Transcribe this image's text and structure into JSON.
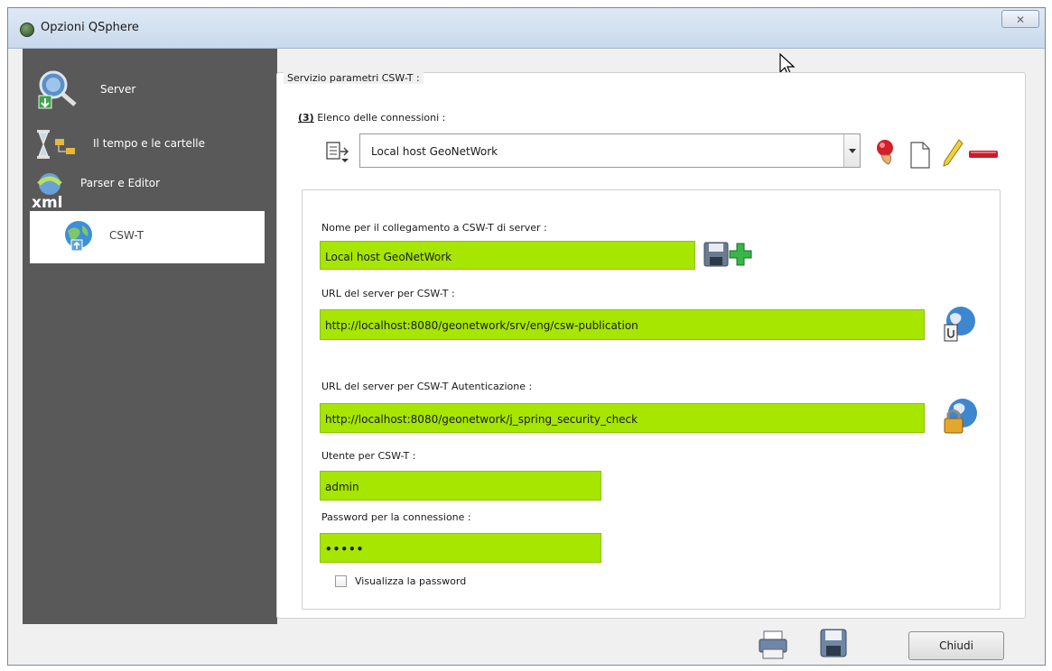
{
  "window": {
    "title": "Opzioni QSphere",
    "close_glyph": "✕"
  },
  "sidebar": {
    "items": [
      {
        "label": "Server",
        "icon": "search-server-icon"
      },
      {
        "label": "Il tempo e le cartelle",
        "icon": "hourglass-folder-icon"
      },
      {
        "label": "Parser e Editor",
        "icon": "xml-icon"
      },
      {
        "label": "CSW-T",
        "icon": "globe-icon",
        "selected": true
      }
    ]
  },
  "panel": {
    "legend": "Servizio parametri CSW-T :",
    "connections_number": "(3)",
    "connections_label": "Elenco delle connessioni :",
    "selected_connection": "Local host GeoNetWork",
    "name_label": "Nome per il collegamento a CSW-T di server :",
    "name_value": "Local host GeoNetWork",
    "url_label": "URL del server per CSW-T :",
    "url_value": "http://localhost:8080/geonetwork/srv/eng/csw-publication",
    "auth_url_label": "URL del server per CSW-T Autenticazione :",
    "auth_url_value": "http://localhost:8080/geonetwork/j_spring_security_check",
    "user_label": "Utente per CSW-T :",
    "user_value": "admin",
    "password_label": "Password per la connessione :",
    "password_value": "•••••",
    "show_password_label": "Visualizza la password"
  },
  "footer": {
    "close_button": "Chiudi"
  },
  "colors": {
    "field_bg": "#a6e600",
    "sidebar_bg": "#595959"
  }
}
